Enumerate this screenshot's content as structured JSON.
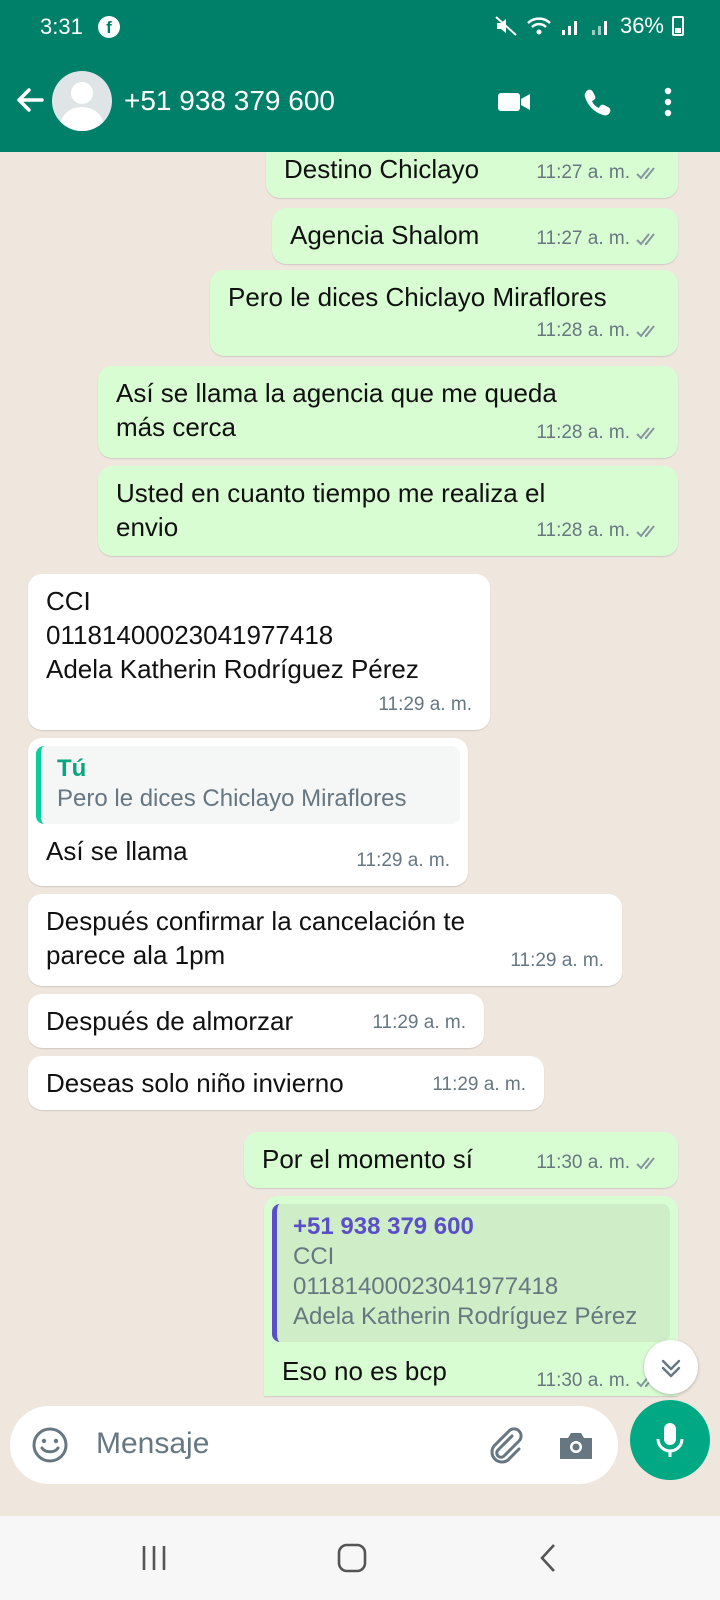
{
  "status_bar": {
    "time": "3:31",
    "battery": "36%"
  },
  "header": {
    "contact": "+51 938 379 600"
  },
  "messages": [
    {
      "dir": "out",
      "text": "Destino Chiclayo",
      "time": "11:27 a. m."
    },
    {
      "dir": "out",
      "text": "Agencia Shalom",
      "time": "11:27 a. m."
    },
    {
      "dir": "out",
      "text": "Pero le dices Chiclayo Miraflores",
      "time": "11:28 a. m."
    },
    {
      "dir": "out",
      "lines": [
        "Así se llama la agencia que me queda",
        "más cerca"
      ],
      "time": "11:28 a. m."
    },
    {
      "dir": "out",
      "lines": [
        "Usted en cuanto tiempo me realiza el",
        "envio"
      ],
      "time": "11:28 a. m."
    },
    {
      "dir": "in",
      "lines": [
        "CCI",
        "01181400023041977418",
        "Adela Katherin Rodríguez Pérez"
      ],
      "time": "11:29 a. m."
    },
    {
      "dir": "in",
      "quote_name": "Tú",
      "quote_text": "Pero le dices Chiclayo Miraflores",
      "text": "Así se llama",
      "time": "11:29 a. m."
    },
    {
      "dir": "in",
      "lines": [
        "Después confirmar la cancelación  te",
        "parece ala 1pm"
      ],
      "time": "11:29 a. m."
    },
    {
      "dir": "in",
      "text": "Después de almorzar",
      "time": "11:29 a. m."
    },
    {
      "dir": "in",
      "text": "Deseas solo niño invierno",
      "time": "11:29 a. m."
    },
    {
      "dir": "out",
      "text": "Por el momento sí",
      "time": "11:30 a. m."
    },
    {
      "dir": "out",
      "quote_name": "+51 938 379 600",
      "quote_lines": [
        "CCI",
        "01181400023041977418",
        "Adela Katherin Rodríguez Pérez"
      ],
      "text": "Eso no es bcp",
      "time": "11:30 a. m."
    }
  ],
  "input": {
    "placeholder": "Mensaje"
  },
  "colors": {
    "header": "#008069",
    "outgoing_bubble": "#d9fdd3",
    "incoming_bubble": "#ffffff",
    "chat_background": "#efe7de",
    "mic_button": "#00a884",
    "quote_self_accent": "#06cf9c",
    "quote_contact_accent": "#5b4fc9"
  },
  "icons": [
    "back-arrow-icon",
    "video-call-icon",
    "phone-call-icon",
    "more-options-icon",
    "emoji-icon",
    "attach-clip-icon",
    "camera-icon",
    "mic-icon",
    "chevron-down-icon",
    "read-ticks-icon"
  ]
}
